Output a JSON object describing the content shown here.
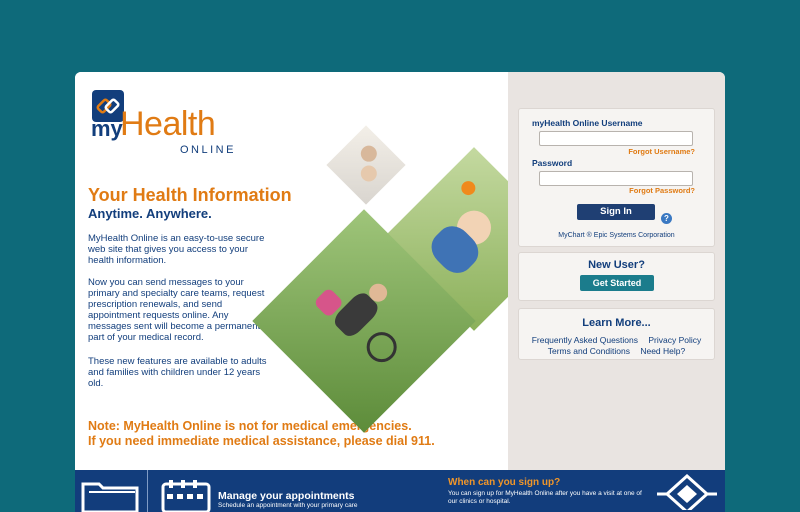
{
  "logo": {
    "my": "my",
    "health": "Health",
    "online": "ONLINE"
  },
  "intro": {
    "headline": "Your Health Information",
    "subhead": "Anytime. Anywhere.",
    "p1": "MyHealth Online is an easy-to-use secure web site that gives you access to your health information.",
    "p2": "Now you can send messages to your primary and specialty care teams, request prescription renewals, and send appointment requests online. Any messages sent will become a permanent part of your medical record.",
    "p3": "These new features are available to adults and families with children under 12 years old.",
    "note_line1": "Note: MyHealth Online is not for medical emergencies.",
    "note_line2": "If you need immediate medical assistance, please dial 911."
  },
  "login": {
    "username_label": "myHealth Online Username",
    "username_value": "",
    "forgot_username": "Forgot Username?",
    "password_label": "Password",
    "password_value": "",
    "forgot_password": "Forgot Password?",
    "signin_label": "Sign In",
    "help_glyph": "?",
    "copyright": "MyChart ® Epic Systems Corporation"
  },
  "new_user": {
    "title": "New User?",
    "button": "Get Started"
  },
  "learn_more": {
    "title": "Learn More...",
    "faq": "Frequently Asked Questions",
    "privacy": "Privacy Policy",
    "terms": "Terms and Conditions",
    "help": "Need Help?"
  },
  "banner": {
    "appointments_title": "Manage your appointments",
    "appointments_text": "Schedule an appointment with your primary care",
    "signup_title": "When can you sign up?",
    "signup_text": "You can sign up for MyHealth Online after you have a visit at one of our clinics or hospital."
  },
  "colors": {
    "background": "#0e6a7a",
    "brand_orange": "#e07b14",
    "brand_navy": "#123e7c",
    "button_teal": "#1b7c8c"
  }
}
